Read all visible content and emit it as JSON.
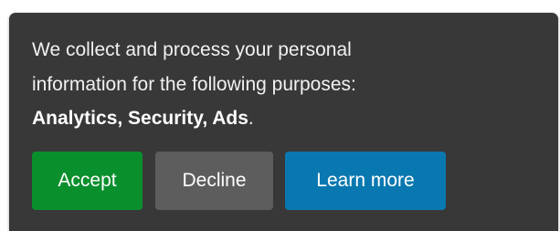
{
  "banner": {
    "message_line_1": "We collect and process your personal",
    "message_line_2": "information for the following purposes:",
    "purposes": "Analytics, Security, Ads",
    "trailing_period": ".",
    "colors": {
      "background": "#383838",
      "text": "#f1f1f1"
    }
  },
  "buttons": {
    "accept": {
      "label": "Accept",
      "color": "#0a8f2d"
    },
    "decline": {
      "label": "Decline",
      "color": "#5d5d5d"
    },
    "learn_more": {
      "label": "Learn more",
      "color": "#0a78b0"
    }
  }
}
